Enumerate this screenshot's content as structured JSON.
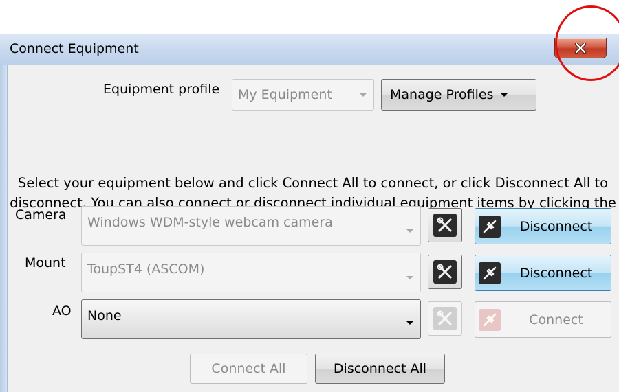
{
  "window": {
    "title": "Connect Equipment",
    "close_symbol": "X"
  },
  "profile": {
    "label": "Equipment profile",
    "selected": "My Equipment",
    "manage_label": "Manage Profiles"
  },
  "instructions": "Select your equipment below and click Connect All to connect, or click Disconnect All to disconnect. You can also connect or disconnect individual equipment items by clicking the button next to the item.",
  "devices": [
    {
      "label": "Camera",
      "selected": "Windows WDM-style webcam camera",
      "action": "Disconnect",
      "state": "connected",
      "setup_icon": "tools-icon",
      "plug_icon": "plug-icon"
    },
    {
      "label": "Mount",
      "selected": "ToupST4 (ASCOM)",
      "action": "Disconnect",
      "state": "connected",
      "setup_icon": "tools-icon",
      "plug_icon": "plug-icon"
    },
    {
      "label": "AO",
      "selected": "None",
      "action": "Connect",
      "state": "disconnected",
      "setup_icon": "tools-icon",
      "plug_icon": "plug-icon"
    }
  ],
  "footer": {
    "connect_all": "Connect All",
    "disconnect_all": "Disconnect All"
  },
  "colors": {
    "highlight_ring": "#e01010",
    "close_button": "#c03a22",
    "connected_button": "#98d1ef"
  }
}
